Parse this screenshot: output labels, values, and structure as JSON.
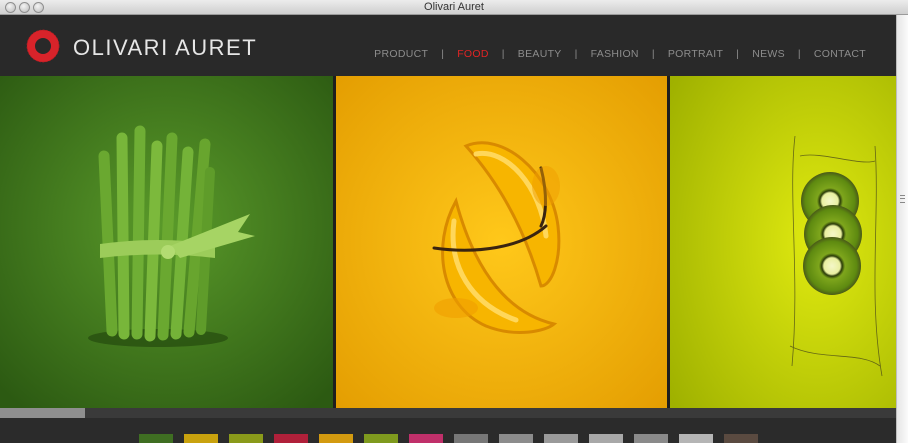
{
  "window": {
    "title": "Olivari Auret"
  },
  "site": {
    "brand": "OLIVARI AURET",
    "accent": "#e02424"
  },
  "nav": {
    "items": [
      {
        "label": "PRODUCT",
        "active": false
      },
      {
        "label": "FOOD",
        "active": true
      },
      {
        "label": "BEAUTY",
        "active": false
      },
      {
        "label": "FASHION",
        "active": false
      },
      {
        "label": "PORTRAIT",
        "active": false
      },
      {
        "label": "NEWS",
        "active": false
      },
      {
        "label": "CONTACT",
        "active": false
      }
    ],
    "separator": "|"
  },
  "gallery": {
    "panels": [
      {
        "subject": "asparagus-bundle",
        "background": "#3f7d1e"
      },
      {
        "subject": "bananas",
        "background": "#f2b400"
      },
      {
        "subject": "kiwi-slices",
        "background": "#c8d400"
      }
    ],
    "progress": 0.095
  },
  "thumbnails": [
    {
      "color": "#3f6e22"
    },
    {
      "color": "#c9a20e"
    },
    {
      "color": "#8a9a1a"
    },
    {
      "color": "#b0203a"
    },
    {
      "color": "#d39a10"
    },
    {
      "color": "#7f9a1e"
    },
    {
      "color": "#c0306a"
    },
    {
      "color": "#777777"
    },
    {
      "color": "#8c8c8c"
    },
    {
      "color": "#9a9a9a"
    },
    {
      "color": "#a8a8a8"
    },
    {
      "color": "#8a8a8a"
    },
    {
      "color": "#b5b5b5"
    },
    {
      "color": "#5a4a40"
    }
  ]
}
